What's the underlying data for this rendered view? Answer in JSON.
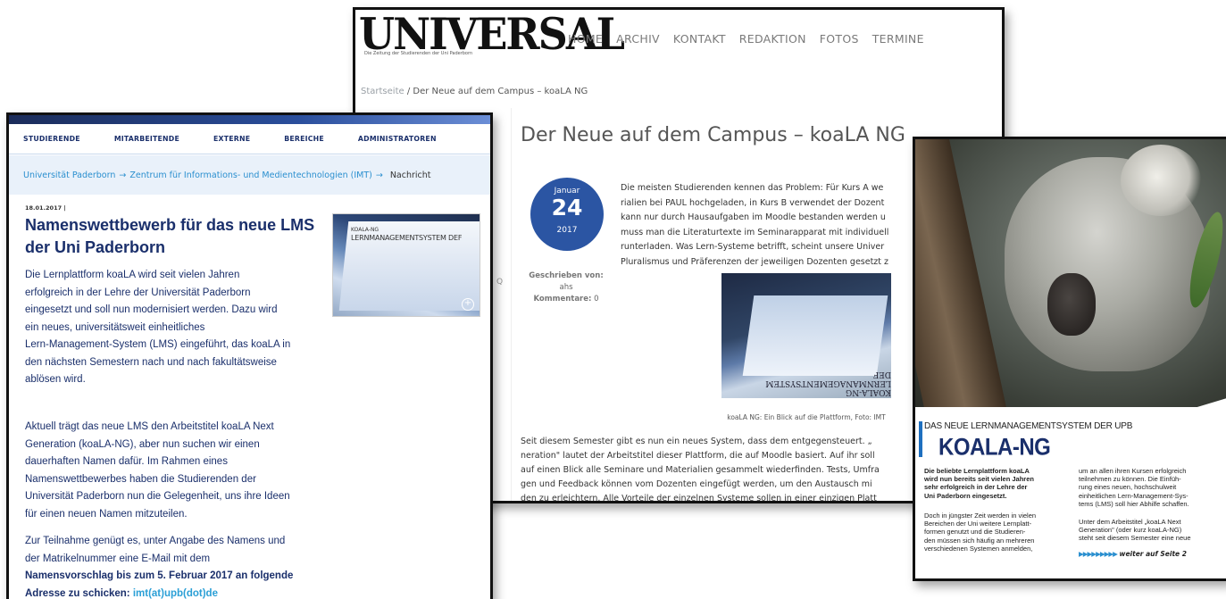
{
  "universal": {
    "logo": "UNIVERSAL",
    "logo_tagline": "Die Zeitung der Studierenden der Uni Paderborn",
    "nav": [
      "HOME",
      "ARCHIV",
      "KONTAKT",
      "REDAKTION",
      "FOTOS",
      "TERMINE"
    ],
    "breadcrumb_home": "Startseite",
    "breadcrumb_sep": " / ",
    "breadcrumb_current": "Der Neue auf dem Campus – koaLA NG",
    "title": "Der Neue auf dem Campus – koaLA NG",
    "date": {
      "month": "Januar",
      "day": "24",
      "year": "2017"
    },
    "meta": {
      "author_label": "Geschrieben von:",
      "author": "ahs",
      "comments_label": "Kommentare:",
      "comments": "0"
    },
    "intro_lines": [
      "Die meisten Studierenden kennen das Problem: Für Kurs A we",
      "rialien bei PAUL hochgeladen, in Kurs B verwendet der Dozent",
      "kann nur durch Hausaufgaben im Moodle bestanden werden u",
      "muss man die Literaturtexte im Seminarapparat mit individuell",
      "runterladen. Was Lern-Systeme betrifft, scheint unsere Univer",
      "Pluralismus und Präferenzen der jeweiligen Dozenten gesetzt z"
    ],
    "photo_text": "KOALA-NG LERNMANAGEMENTSYSTEM DEF",
    "caption": "koaLA NG: Ein Blick auf die Plattform, Foto: IMT",
    "body_lines": [
      "Seit diesem Semester gibt es nun ein neues System, dass dem entgegensteuert. „",
      "neration\" lautet der Arbeitstitel dieser Plattform, die auf Moodle basiert. Auf ihr soll",
      "auf einen Blick alle Seminare und Materialien gesammelt wiederfinden. Tests, Umfra",
      "gen und Feedback können vom Dozenten eingefügt werden, um den Austausch mi",
      "den zu erleichtern. Alle Vorteile der einzelnen Systeme sollen in einer einzigen Platt"
    ]
  },
  "upb": {
    "nav": [
      "STUDIERENDE",
      "MITARBEITENDE",
      "EXTERNE",
      "BEREICHE",
      "ADMINISTRATOREN"
    ],
    "breadcrumb": [
      "Universität Paderborn",
      "Zentrum für Informations- und Medientechnologien (IMT)"
    ],
    "breadcrumb_current": "Nachricht",
    "breadcrumb_arrow": "→",
    "date": "18.01.2017 |",
    "title_lines": [
      "Namenswettbewerb für das neue LMS",
      "der Uni Paderborn"
    ],
    "thumb_line1": "KOALA-NG",
    "thumb_line2": "LERNMANAGEMENTSYSTEM DEF",
    "p1": [
      "Die Lernplattform koaLA wird seit vielen Jahren",
      "erfolgreich in der Lehre der Universität Paderborn",
      "eingesetzt und soll nun modernisiert werden. Dazu wird",
      "ein neues, universitätsweit einheitliches",
      "Lern-Management-System (LMS) eingeführt, das koaLA in",
      "den nächsten Semestern nach und nach fakultätsweise",
      "ablösen wird."
    ],
    "p2": [
      "Aktuell trägt das neue LMS den Arbeitstitel koaLA Next",
      "Generation (koaLA-NG), aber nun suchen wir einen",
      "dauerhaften Namen dafür. Im Rahmen eines",
      "Namenswettbewerbes haben die Studierenden der",
      "Universität Paderborn nun die Gelegenheit, uns ihre Ideen",
      "für einen neuen Namen mitzuteilen."
    ],
    "p3": [
      "Zur Teilnahme genügt es, unter Angabe des Namens und",
      "der Matrikelnummer eine E-Mail mit dem"
    ],
    "p3_bold1": "Namensvorschlag bis zum 5. Februar 2017 an folgende",
    "p3_bold2": "Adresse zu schicken: ",
    "p3_link": "imt(at)upb(dot)de"
  },
  "koala": {
    "kicker": "DAS NEUE LERNMANAGEMENTSYSTEM DER UPB",
    "title": "KOALA-NG",
    "lead": [
      "Die beliebte Lernplattform koaLA",
      "wird nun bereits seit vielen Jahren",
      "sehr erfolgreich in der Lehre der",
      "Uni Paderborn eingesetzt."
    ],
    "col_left": [
      "Doch in jüngster Zeit werden in vielen",
      "Bereichen der Uni weitere Lernplatt-",
      "formen genutzt und die Studieren-",
      "den müssen sich häufig an mehreren",
      "verschiedenen Systemen anmelden,"
    ],
    "col_right_1": [
      "um an allen ihren Kursen erfolgreich",
      "teilnehmen zu können. Die Einfüh-",
      "rung eines neuen, hochschulweit",
      "einheitlichen Lern-Management-Sys-",
      "tems (LMS) soll hier Abhilfe schaffen."
    ],
    "col_right_2": [
      "Unter dem Arbeitstitel „koaLA Next",
      "Generation\" (oder kurz koaLA-NG)",
      "steht seit diesem Semester eine neue"
    ],
    "more_arrows": "▶▶▶▶▶▶▶▶▶",
    "more": "weiter auf Seite 2"
  }
}
